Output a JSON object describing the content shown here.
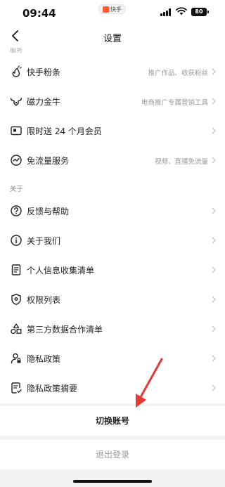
{
  "status_bar": {
    "time": "09:44",
    "app_pill": "快手",
    "battery": "80"
  },
  "nav": {
    "title": "设置"
  },
  "list": {
    "cut_section_header": "服务",
    "items_top": [
      {
        "label": "快手粉条",
        "value": "推广作品、收获粉丝",
        "icon": "fire-sprout-icon"
      },
      {
        "label": "磁力金牛",
        "value": "电商推广专属营销工具",
        "icon": "bull-icon"
      },
      {
        "label": "限时送 24 个月会员",
        "value": "",
        "icon": "wallet-icon"
      },
      {
        "label": "免流量服务",
        "value": "视频、直播免流量",
        "icon": "speed-icon"
      }
    ],
    "about_header": "关于",
    "items_about": [
      {
        "label": "反馈与帮助",
        "icon": "help-icon"
      },
      {
        "label": "关于我们",
        "icon": "info-icon"
      },
      {
        "label": "个人信息收集清单",
        "icon": "document-icon"
      },
      {
        "label": "权限列表",
        "icon": "shield-icon"
      },
      {
        "label": "第三方数据合作清单",
        "icon": "shapes-icon"
      },
      {
        "label": "隐私政策",
        "icon": "person-lock-icon"
      },
      {
        "label": "隐私政策摘要",
        "icon": "document-check-icon"
      }
    ]
  },
  "actions": {
    "switch_account": "切换账号",
    "logout": "退出登录"
  },
  "annotation": {
    "arrow_color": "#e53935"
  }
}
